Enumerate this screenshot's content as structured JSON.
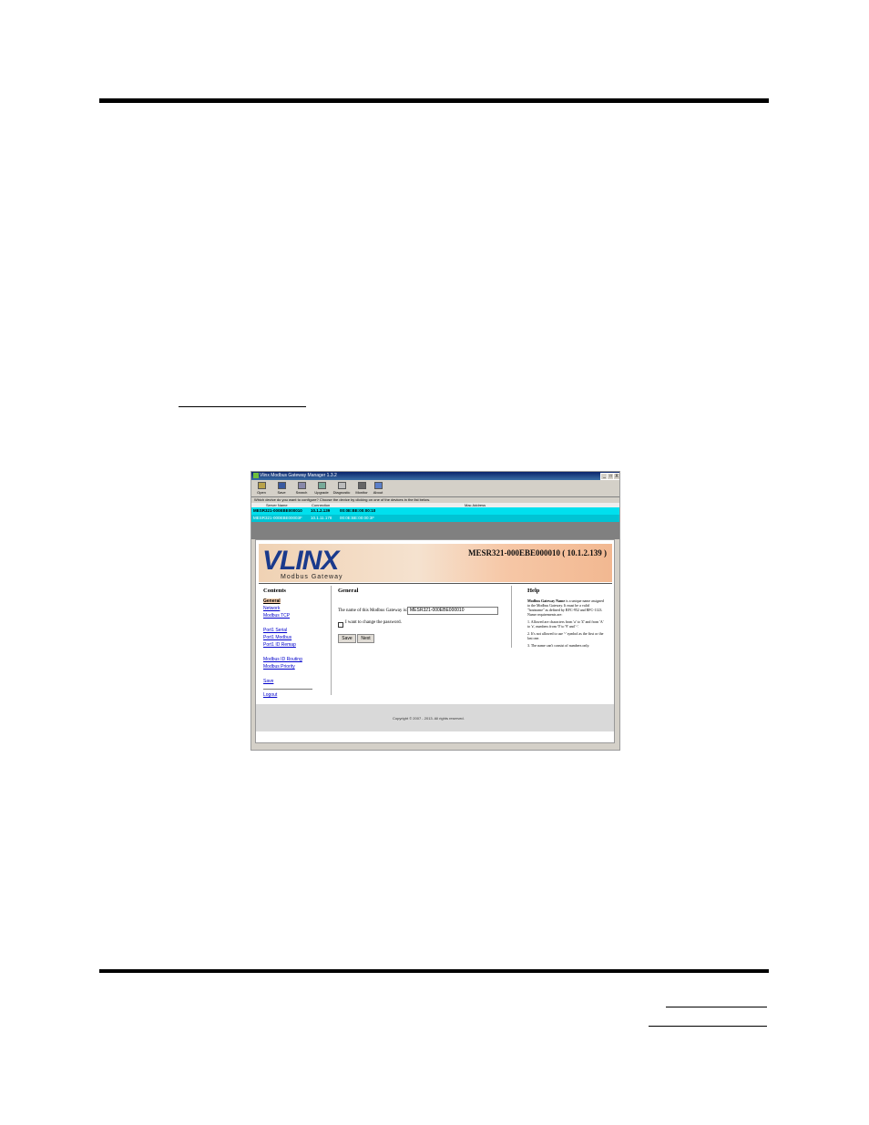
{
  "window": {
    "title": "Vlinx Modbus Gateway Manager 1.3.2",
    "min_label": "_",
    "max_label": "□",
    "close_label": "X"
  },
  "toolbar": [
    {
      "label": "Open",
      "icon": "folder-icon"
    },
    {
      "label": "Save",
      "icon": "save-icon"
    },
    {
      "label": "Search",
      "icon": "search-icon"
    },
    {
      "label": "Upgrade",
      "icon": "upgrade-icon"
    },
    {
      "label": "Diagnostic",
      "icon": "diagnostic-icon"
    },
    {
      "label": "Monitor",
      "icon": "monitor-icon"
    },
    {
      "label": "About",
      "icon": "help-icon"
    }
  ],
  "prompt": "Which device do you want to configure? Choose the device by clicking on one of the devices in the list below.",
  "device_grid": {
    "headers": [
      "Server Name",
      "Connection",
      "Mac Address"
    ],
    "rows": [
      {
        "name": "MESR321-000EBE000010",
        "connection": "10.1.2.139",
        "mac": "00:0E:BE:00:00:10"
      },
      {
        "name": "MESR321-000EBE00003F",
        "connection": "10.1.11.178",
        "mac": "00:0E:BE:00:00:3F"
      }
    ]
  },
  "banner": {
    "logo": "VLINX",
    "subtitle": "Modbus Gateway",
    "device": "MESR321-000EBE000010 ( 10.1.2.139 )"
  },
  "contents": {
    "title": "Contents",
    "links": [
      "General",
      "Network",
      "Modbus TCP",
      "Port1 Serial",
      "Port1 Modbus",
      "Port1 ID Remap",
      "Modbus ID Routing",
      "Modbus Priority",
      "Save",
      "Logout"
    ]
  },
  "general": {
    "title": "General",
    "name_label": "The name of this Modbus Gateway is:",
    "name_value": "MESR321-000EBE000010",
    "password_label": "I want to change the password.",
    "save_button": "Save",
    "next_button": "Next"
  },
  "help": {
    "title": "Help",
    "p1_bold": "Modbus Gateway Name",
    "p1": " is a unique name assigned to the Modbus Gateway. It must be a valid \"hostname\" as defined by RFC-952 and RFC-1123. Name requirements are:",
    "p2": "1. Allowed are characters from 'a' to 'Z' and from 'A' to 'z', numbers from '0' to '9' and '-'.",
    "p3": "2. It's not allowed to use '-' symbol as the first or the last one.",
    "p4": "3. The name can't consist of numbers only."
  },
  "footer": "Copyright © 2007 - 2013. All rights reserved."
}
